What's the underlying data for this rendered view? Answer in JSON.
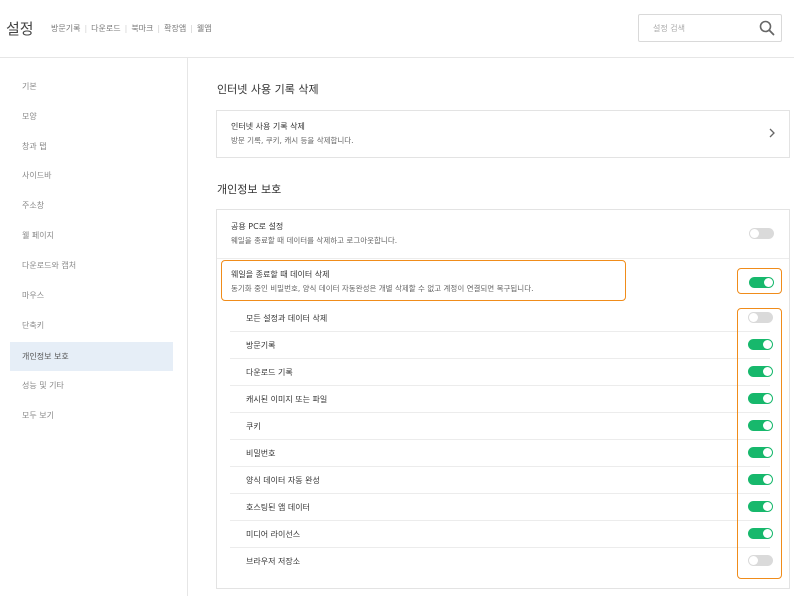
{
  "header": {
    "title": "설정",
    "links": [
      "방문기록",
      "다운로드",
      "북마크",
      "확장앱",
      "웰앱"
    ],
    "search_placeholder": "설정 검색"
  },
  "sidebar": {
    "items": [
      {
        "label": "기본"
      },
      {
        "label": "모양"
      },
      {
        "label": "창과 탭"
      },
      {
        "label": "사이드바"
      },
      {
        "label": "주소창"
      },
      {
        "label": "웰 페이지"
      },
      {
        "label": "다운로드와 캡처"
      },
      {
        "label": "마우스"
      },
      {
        "label": "단축키"
      },
      {
        "label": "개인정보 보호",
        "active": true
      },
      {
        "label": "성능 및 기타"
      },
      {
        "label": "모두 보기"
      }
    ]
  },
  "main": {
    "section1": {
      "title": "인터넷 사용 기록 삭제",
      "row": {
        "title": "인터넷 사용 기록 삭제",
        "desc": "방문 기록, 쿠키, 캐시 등을 삭제합니다."
      }
    },
    "section2": {
      "title": "개인정보 보호",
      "public_pc": {
        "title": "공용 PC로 설정",
        "desc": "웨일을 종료할 때 데이터를 삭제하고 로그아웃합니다.",
        "on": false
      },
      "delete_on_exit": {
        "title": "웨일을 종료할 때 데이터 삭제",
        "desc": "동기화 중인 비밀번호, 양식 데이터 자동완성은 개별 삭제할 수 없고 계정이 연결되면 복구됩니다.",
        "on": true
      },
      "items": [
        {
          "label": "모든 설정과 데이터 삭제",
          "on": false
        },
        {
          "label": "방문기록",
          "on": true
        },
        {
          "label": "다운로드 기록",
          "on": true
        },
        {
          "label": "캐시된 이미지 또는 파일",
          "on": true
        },
        {
          "label": "쿠키",
          "on": true
        },
        {
          "label": "비밀번호",
          "on": true
        },
        {
          "label": "양식 데이터 자동 완성",
          "on": true
        },
        {
          "label": "호스팅된 앱 데이터",
          "on": true
        },
        {
          "label": "미디어 라이선스",
          "on": true
        },
        {
          "label": "브라우저 저장소",
          "on": false
        }
      ]
    }
  },
  "colors": {
    "toggle_on": "#17b86c",
    "toggle_off": "#dadada",
    "highlight": "#f08c1a",
    "active_nav": "#e6eef7"
  }
}
